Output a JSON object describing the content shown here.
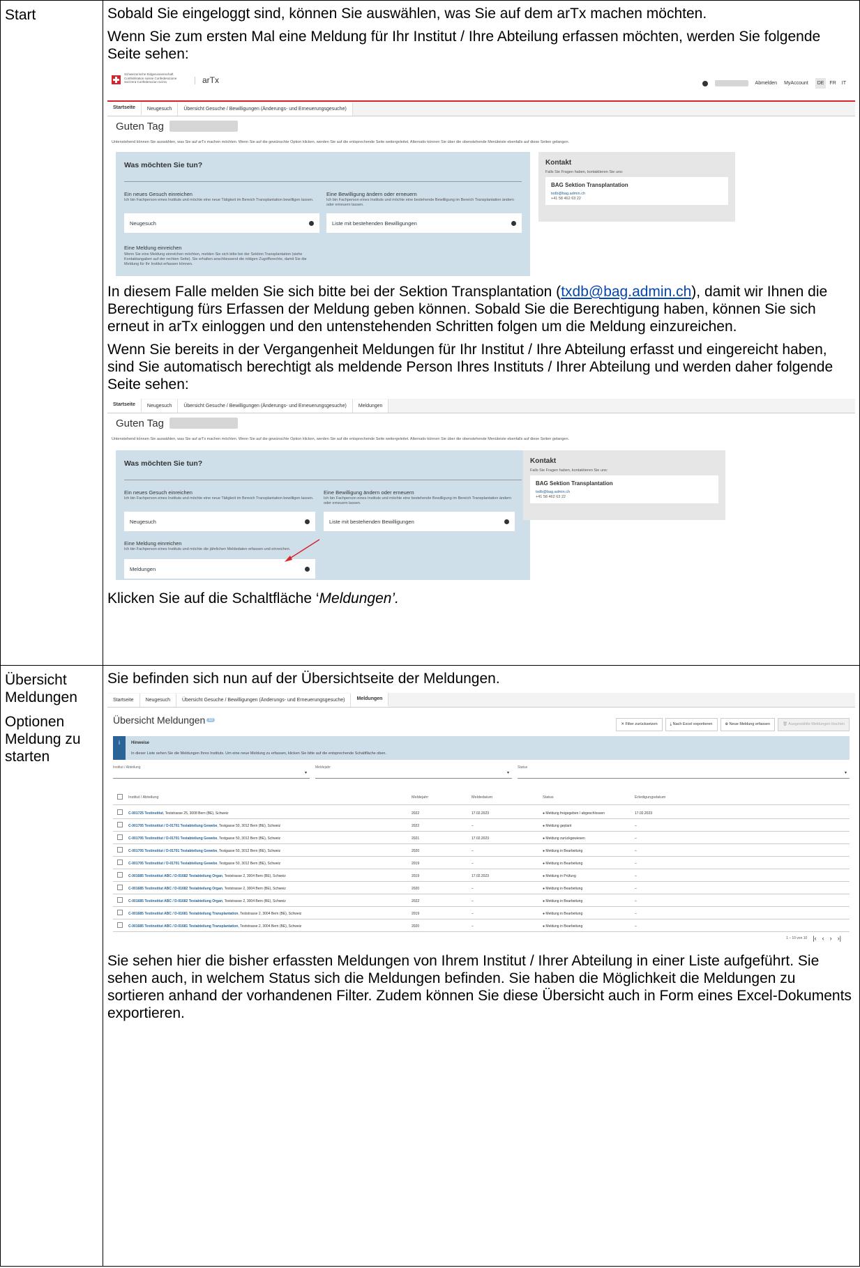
{
  "rows": [
    {
      "label": [
        "Start"
      ],
      "p1": "Sobald Sie eingeloggt sind, können Sie auswählen, was Sie auf dem arTx machen möchten.",
      "p2": "Wenn Sie zum ersten Mal eine Meldung für Ihr Institut / Ihre Abteilung erfassen möchten, werden Sie folgende Seite sehen:",
      "p3_before": "In diesem Falle melden Sie sich bitte bei der Sektion Transplantation (",
      "p3_link": "txdb@bag.admin.ch",
      "p3_after": "), damit wir Ihnen die Berechtigung fürs Erfassen der Meldung geben können. Sobald Sie die Berechtigung haben, können Sie sich erneut in arTx einloggen und den untenstehenden Schritten folgen um die Meldung einzureichen.",
      "p4": "Wenn Sie bereits in der Vergangenheit Meldungen für Ihr Institut / Ihre Abteilung erfasst und eingereicht haben, sind Sie automatisch berechtigt als meldende Person Ihres Instituts / Ihrer Abteilung und werden daher folgende Seite sehen:",
      "p5_before": "Klicken Sie auf die Schaltfläche ‘",
      "p5_em": "Meldungen’.",
      "p5_after": ""
    },
    {
      "label": [
        "Übersicht Meldungen",
        "Optionen Meldung zu starten"
      ],
      "p1": "Sie befinden sich nun auf der Übersichtseite der Meldungen.",
      "p2": "Sie sehen hier die bisher erfassten Meldungen von Ihrem Institut / Ihrer Abteilung in einer Liste aufgeführt. Sie sehen auch, in welchem Status sich die Meldungen befinden. Sie haben die Möglichkeit die Meldungen zu sortieren anhand der vorhandenen Filter. Zudem können Sie diese Übersicht auch in Form eines Excel-Dokuments exportieren."
    }
  ],
  "app": {
    "confederation": "Schweizerische Eidgenossenschaft Confédération suisse Confederazione Svizzera Confederaziun svizra",
    "title": "arTx",
    "logout": "Abmelden",
    "account": "MyAccount",
    "langs": [
      "DE",
      "FR",
      "IT"
    ],
    "tabs": [
      "Startseite",
      "Neugesuch",
      "Übersicht Gesuche / Bewilligungen (Änderungs- und Erneuerungsgesuche)",
      "Meldungen"
    ],
    "greeting": "Guten Tag",
    "intro": "Untenstehend können Sie auswählen, was Sie auf arTx machen möchten. Wenn Sie auf die gewünschte Option klicken, werden Sie auf die entsprechende Seite weitergeleitet. Alternativ können Sie über die obenstehende Menüleiste ebenfalls auf diese Seiten gelangen.",
    "panel_title": "Was möchten Sie tun?",
    "opt1_title": "Ein neues Gesuch einreichen",
    "opt1_desc": "Ich bin Fachperson eines Instituts und möchte eine neue Tätigkeit im Bereich Transplantation bewilligen lassen.",
    "opt1_card": "Neugesuch",
    "opt2_title": "Eine Bewilligung ändern oder erneuern",
    "opt2_desc": "Ich bin Fachperson eines Instituts und möchte eine bestehende Bewilligung im Bereich Transplantation ändern oder erneuern lassen.",
    "opt2_card": "Liste mit bestehenden Bewilligungen",
    "opt3_title": "Eine Meldung einreichen",
    "opt3_desc_noperm": "Wenn Sie eine Meldung einreichen möchten, melden Sie sich bitte bei der Sektion Transplantation (siehe Kontaktangaben auf der rechten Seite). Sie erhalten anschliessend die nötigen Zugriffsrechte, damit Sie die Meldung für Ihr Institut erfassen können.",
    "opt3_desc_perm": "Ich bin Fachperson eines Instituts und möchte die jährlichen Meldedaten erfassen und einreichen.",
    "opt3_card": "Meldungen",
    "contact_title": "Kontakt",
    "contact_sub": "Falls Sie Fragen haben, kontaktieren Sie uns:",
    "contact_name": "BAG Sektion Transplantation",
    "contact_mail": "txdb@bag.admin.ch",
    "contact_phone": "+41 58 462 63 22"
  },
  "overview": {
    "title": "Übersicht Meldungen",
    "count": "10",
    "buttons": [
      "Filter zurücksetzen",
      "Nach Excel exportieren",
      "Neue Meldung erfassen",
      "Ausgewählte Meldungen löschen"
    ],
    "hint_title": "Hinweise",
    "hint_text": "In dieser Liste sehen Sie die Meldungen Ihres Instituts. Um eine neue Meldung zu erfassen, klicken Sie bitte auf die entsprechende Schaltfläche oben.",
    "filters": [
      "Institut / Abteilung",
      "Meldejahr",
      "Status"
    ],
    "columns": [
      "Institut / Abteilung",
      "Meldejahr",
      "Meldedatum",
      "Status",
      "Erledigungsdatum"
    ],
    "list": [
      {
        "inst": "C-001725 Testinstitut",
        "addr": ", Teststrasse 25, 3008 Bern (BE), Schweiz",
        "year": "2022",
        "date": "17.02.2023",
        "status": "Meldung freigegeben / abgeschlossen",
        "done": "17.02.2023"
      },
      {
        "inst": "C-001705 Testinstitut / D-01701 Testabteilung Gewebe",
        "addr": ", Testgasse 50, 3012 Bern (BE), Schweiz",
        "year": "2022",
        "date": "–",
        "status": "Meldung geplant",
        "done": "–"
      },
      {
        "inst": "C-001705 Testinstitut / D-01701 Testabteilung Gewebe",
        "addr": ", Testgasse 50, 3012 Bern (BE), Schweiz",
        "year": "2021",
        "date": "17.02.2023",
        "status": "Meldung zurückgewiesen",
        "done": "–"
      },
      {
        "inst": "C-001705 Testinstitut / D-01701 Testabteilung Gewebe",
        "addr": ", Testgasse 50, 3012 Bern (BE), Schweiz",
        "year": "2020",
        "date": "–",
        "status": "Meldung in Bearbeitung",
        "done": "–"
      },
      {
        "inst": "C-001705 Testinstitut / D-01701 Testabteilung Gewebe",
        "addr": ", Testgasse 50, 3012 Bern (BE), Schweiz",
        "year": "2019",
        "date": "–",
        "status": "Meldung in Bearbeitung",
        "done": "–"
      },
      {
        "inst": "C-001685 Testinstitut ABC / D-01682 Testabteilung Organ",
        "addr": ", Teststrasse 2, 3004 Bern (BE), Schweiz",
        "year": "2019",
        "date": "17.02.2023",
        "status": "Meldung in Prüfung",
        "done": "–"
      },
      {
        "inst": "C-001685 Testinstitut ABC / D-01682 Testabteilung Organ",
        "addr": ", Teststrasse 2, 3004 Bern (BE), Schweiz",
        "year": "2020",
        "date": "–",
        "status": "Meldung in Bearbeitung",
        "done": "–"
      },
      {
        "inst": "C-001685 Testinstitut ABC / D-01682 Testabteilung Organ",
        "addr": ", Teststrasse 2, 3004 Bern (BE), Schweiz",
        "year": "2022",
        "date": "–",
        "status": "Meldung in Bearbeitung",
        "done": "–"
      },
      {
        "inst": "C-001685 Testinstitut ABC / D-01681 Testabteilung Transplantation",
        "addr": ", Teststrasse 2, 3004 Bern (BE), Schweiz",
        "year": "2019",
        "date": "–",
        "status": "Meldung in Bearbeitung",
        "done": "–"
      },
      {
        "inst": "C-001685 Testinstitut ABC / D-01681 Testabteilung Transplantation",
        "addr": ", Teststrasse 2, 3004 Bern (BE), Schweiz",
        "year": "2020",
        "date": "–",
        "status": "Meldung in Bearbeitung",
        "done": "–"
      }
    ],
    "pagination": "1 – 10 von 10"
  },
  "colors": {
    "red": "#d8232a",
    "panel": "#cfdfea",
    "link": "#0645ad",
    "accent": "#2a6496"
  }
}
